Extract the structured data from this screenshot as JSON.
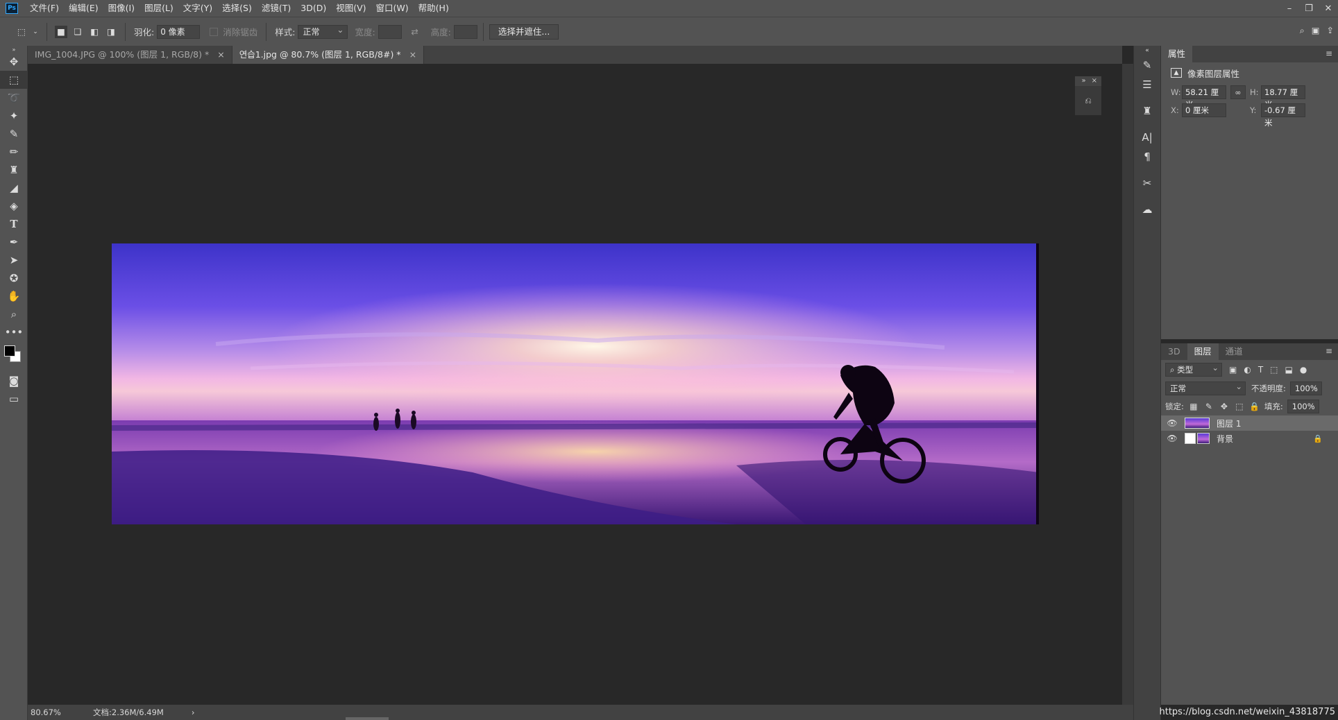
{
  "app": {
    "logo": "Ps"
  },
  "menu": [
    "文件(F)",
    "编辑(E)",
    "图像(I)",
    "图层(L)",
    "文字(Y)",
    "选择(S)",
    "滤镜(T)",
    "3D(D)",
    "视图(V)",
    "窗口(W)",
    "帮助(H)"
  ],
  "options": {
    "feather_label": "羽化:",
    "feather_value": "0 像素",
    "antialias_label": "消除锯齿",
    "style_label": "样式:",
    "style_value": "正常",
    "width_label": "宽度:",
    "height_label": "高度:",
    "select_mask_button": "选择并遮住..."
  },
  "tabs": [
    {
      "label": "IMG_1004.JPG @ 100% (图层 1, RGB/8) *",
      "active": false
    },
    {
      "label": "연습1.jpg @ 80.7% (图层 1, RGB/8#) *",
      "active": true
    }
  ],
  "status": {
    "zoom": "80.67%",
    "doc": "文档:2.36M/6.49M"
  },
  "properties": {
    "tab": "属性",
    "subtitle": "像素图层属性",
    "w_label": "W:",
    "w_value": "58.21 厘米",
    "h_label": "H:",
    "h_value": "18.77 厘米",
    "x_label": "X:",
    "x_value": "0 厘米",
    "y_label": "Y:",
    "y_value": "-0.67 厘米"
  },
  "layers_panel": {
    "tabs": [
      "3D",
      "图层",
      "通道"
    ],
    "active_tab": "图层",
    "filter_label": "类型",
    "blend_mode": "正常",
    "opacity_label": "不透明度:",
    "opacity_value": "100%",
    "lock_label": "锁定:",
    "fill_label": "填充:",
    "fill_value": "100%",
    "layers": [
      {
        "name": "图层 1",
        "selected": true,
        "locked": false
      },
      {
        "name": "背景",
        "selected": false,
        "locked": true
      }
    ]
  },
  "watermark": "https://blog.csdn.net/weixin_43818775",
  "colors": {
    "accent": "#31a8ff",
    "ui_bg": "#535353",
    "canvas_bg": "#282828"
  }
}
